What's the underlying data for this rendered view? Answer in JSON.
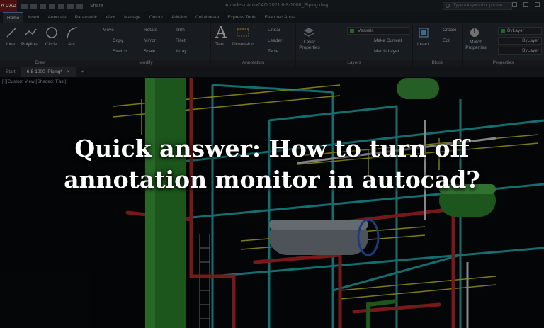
{
  "titlebar": {
    "app_label": "A CAD",
    "share_label": "Share",
    "title": "Autodesk AutoCAD 2021    6-8-1000_Piping.dwg",
    "search_placeholder": "Type a keyword or phrase"
  },
  "ribbon_tabs": [
    "Home",
    "Insert",
    "Annotate",
    "Parametric",
    "View",
    "Manage",
    "Output",
    "Add-ins",
    "Collaborate",
    "Express Tools",
    "Featured Apps"
  ],
  "ribbon": {
    "draw": {
      "title": "Draw",
      "tools": [
        "Line",
        "Polyline",
        "Circle",
        "Arc"
      ]
    },
    "modify": {
      "title": "Modify",
      "tools": [
        "Move",
        "Rotate",
        "Trim",
        "Copy",
        "Mirror",
        "Fillet",
        "Stretch",
        "Scale",
        "Array"
      ]
    },
    "annotation": {
      "title": "Annotation",
      "tools": [
        "Text",
        "Dimension",
        "Linear",
        "Leader",
        "Table"
      ]
    },
    "layers": {
      "title": "Layers",
      "layer_properties": "Layer Properties",
      "current_layer": "Vessels",
      "make_current": "Make Current",
      "match_layer": "Match Layer"
    },
    "block": {
      "title": "Block",
      "insert": "Insert",
      "create": "Create",
      "edit": "Edit"
    },
    "properties": {
      "title": "Properties",
      "match_properties": "Match Properties",
      "bylayer": "ByLayer"
    }
  },
  "doc_tabs": {
    "start": "Start",
    "active": "6-8-1000_Piping*",
    "add": "+"
  },
  "viewport_label": "[-][Custom View][Shaded (Fast)]",
  "headline": {
    "line1": "Quick answer: How to turn off",
    "line2": "annotation monitor in autocad?"
  },
  "colors": {
    "accent": "#4a90d9",
    "pipe_green": "#2e8b2e",
    "steel_cyan": "#1fb4b4",
    "steel_yellow": "#c8c81e",
    "pipe_red": "#c0282c"
  }
}
